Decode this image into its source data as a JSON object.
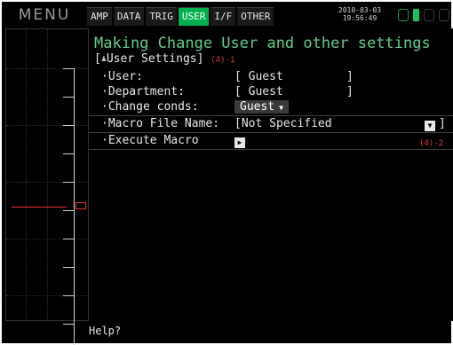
{
  "header": {
    "menu_title": "MENU",
    "tabs": [
      {
        "label": "AMP",
        "active": false
      },
      {
        "label": "DATA",
        "active": false
      },
      {
        "label": "TRIG",
        "active": false
      },
      {
        "label": "USER",
        "active": true
      },
      {
        "label": "I/F",
        "active": false
      },
      {
        "label": "OTHER",
        "active": false
      }
    ],
    "date": "2010-03-03",
    "time": "19:56:49",
    "status_icons": [
      "memory-icon",
      "battery-icon",
      "usb-icon",
      "storage-icon"
    ]
  },
  "content": {
    "title": "Making Change User and other settings",
    "section_open": "[",
    "section_label": "User Settings]",
    "section_ref": "(4)-1",
    "fields": [
      {
        "label": "·User:",
        "value": "[ Guest",
        "value_end": "]"
      },
      {
        "label": "·Department:",
        "value": "[ Guest",
        "value_end": "]"
      },
      {
        "label": "·Change conds:",
        "value": "Guest",
        "arrow": "▼"
      },
      {
        "label": "·Macro File Name:",
        "value": "[Not Specified",
        "button": "▼",
        "value_end": "]"
      },
      {
        "label": "·Execute Macro",
        "button": "▶",
        "ref": "(4)-2"
      }
    ]
  },
  "footer": {
    "help": "Help?"
  },
  "colors": {
    "accent_green": "#5fd08a",
    "tab_active": "#00b050",
    "reference_red": "#e23a3a",
    "background": "#000000"
  }
}
